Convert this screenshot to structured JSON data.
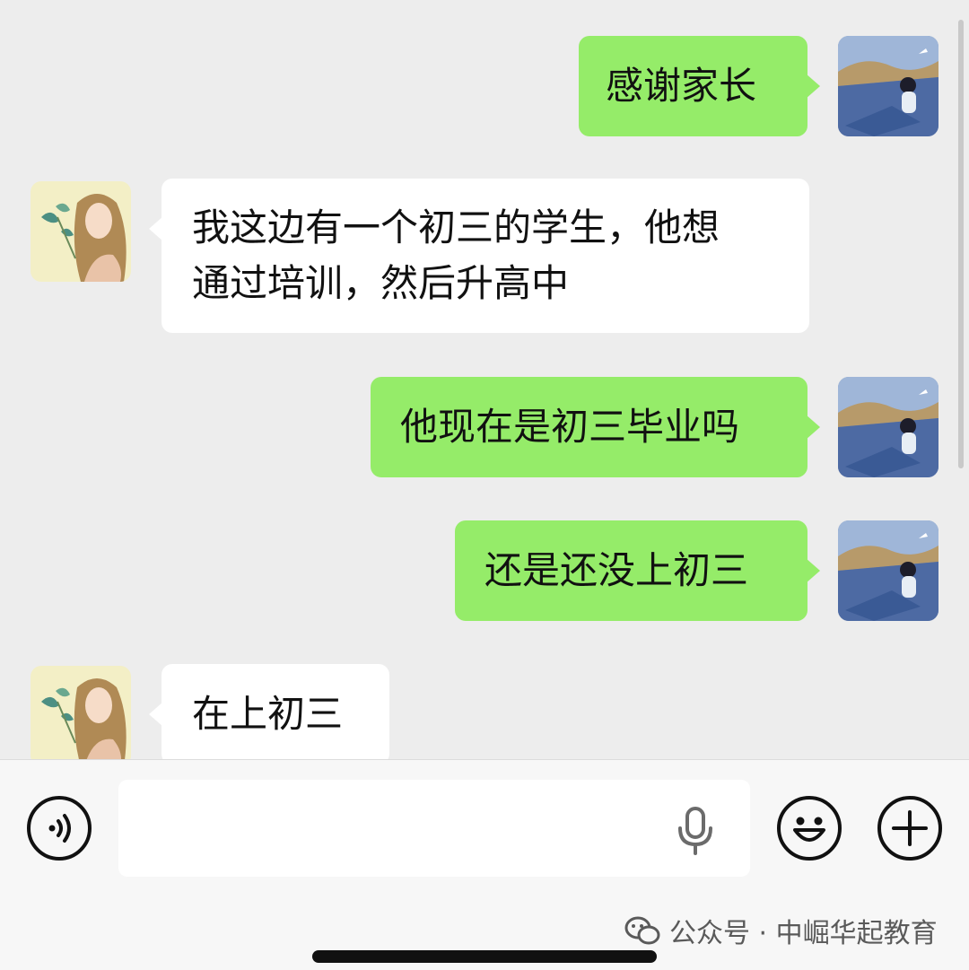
{
  "messages": [
    {
      "sender": "me",
      "lines": [
        "感谢家长"
      ]
    },
    {
      "sender": "contact",
      "lines": [
        "我这边有一个初三的学生，他想",
        "通过培训，然后升高中"
      ]
    },
    {
      "sender": "me",
      "lines": [
        "他现在是初三毕业吗"
      ]
    },
    {
      "sender": "me",
      "lines": [
        "还是还没上初三"
      ]
    },
    {
      "sender": "contact",
      "lines": [
        "在上初三"
      ]
    }
  ],
  "input": {
    "value": "",
    "placeholder": ""
  },
  "icons": {
    "voice": "voice-mode-icon",
    "mic": "microphone-icon",
    "emoji": "emoji-icon",
    "plus": "plus-icon"
  },
  "watermark": {
    "text": "公众号 · 中崛华起教育"
  },
  "colors": {
    "outgoing_bubble": "#95ec69",
    "incoming_bubble": "#ffffff",
    "background": "#ededed"
  }
}
